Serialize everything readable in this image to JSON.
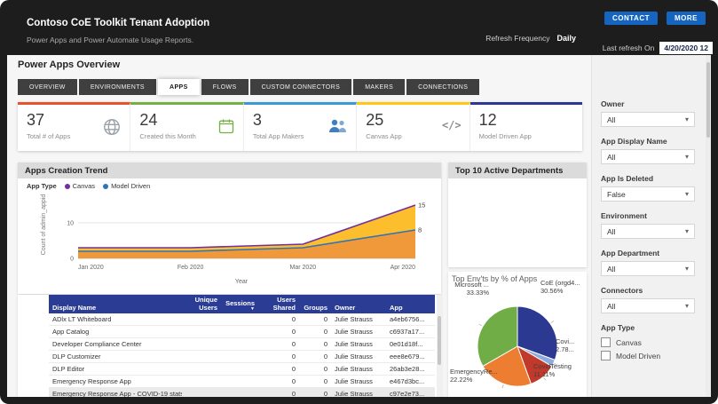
{
  "header": {
    "title": "Contoso CoE Toolkit Tenant Adoption",
    "subtitle": "Power Apps and Power Automate Usage Reports.",
    "contact_label": "CONTACT",
    "more_label": "MORE",
    "refresh_frequency_label": "Refresh Frequency",
    "refresh_frequency_value": "Daily",
    "last_refresh_label": "Last refresh On",
    "last_refresh_value": "4/20/2020 12"
  },
  "page": {
    "title": "Power Apps Overview",
    "tabs": [
      {
        "label": "OVERVIEW",
        "active": false
      },
      {
        "label": "ENVIRONMENTS",
        "active": false
      },
      {
        "label": "APPS",
        "active": true
      },
      {
        "label": "FLOWS",
        "active": false
      },
      {
        "label": "CUSTOM CONNECTORS",
        "active": false
      },
      {
        "label": "MAKERS",
        "active": false
      },
      {
        "label": "CONNECTIONS",
        "active": false
      }
    ]
  },
  "kpis": [
    {
      "value": "37",
      "label": "Total # of Apps",
      "icon": "globe-icon",
      "accent": "#E8532E"
    },
    {
      "value": "24",
      "label": "Created this Month",
      "icon": "calendar-icon",
      "accent": "#74B045"
    },
    {
      "value": "3",
      "label": "Total App Makers",
      "icon": "people-icon",
      "accent": "#3B99D4"
    },
    {
      "value": "25",
      "label": "Canvas App",
      "icon": "code-icon",
      "accent": "#FFC716"
    },
    {
      "value": "12",
      "label": "Model Driven App",
      "icon": null,
      "accent": "#2B3990"
    }
  ],
  "panels": {
    "departments_title": "Top 10 Active Departments"
  },
  "chart_data": [
    {
      "type": "area",
      "title": "Apps Creation Trend",
      "legend_title": "App Type",
      "x": [
        "Jan 2020",
        "Feb 2020",
        "Mar 2020",
        "Apr 2020"
      ],
      "series": [
        {
          "name": "Canvas",
          "values": [
            3,
            3,
            4,
            15
          ],
          "stroke": "#71309F",
          "fill": "#FDBE2E"
        },
        {
          "name": "Model Driven",
          "values": [
            2,
            2,
            3,
            8
          ],
          "stroke": "#2E75B6",
          "fill": "#F0993A"
        }
      ],
      "xlabel": "Year",
      "ylabel": "Count of admin_appid",
      "ylim": [
        0,
        15
      ],
      "yticks": [
        0,
        10
      ],
      "end_labels": [
        "15",
        "8"
      ],
      "legend_position": "top-left",
      "grid": true
    },
    {
      "type": "pie",
      "title": "Top Env'ts by % of Apps",
      "slices": [
        {
          "label": "CoE (orgd4...",
          "pct": 30.56,
          "pct_label": "30.56%",
          "color": "#2B3990"
        },
        {
          "label": "Covi...",
          "pct": 2.78,
          "pct_label": "2.78...",
          "color": "#8FAADC"
        },
        {
          "label": "CovidTesting",
          "pct": 11.11,
          "pct_label": "11.11%",
          "color": "#C0392B"
        },
        {
          "label": "EmergencyRe...",
          "pct": 22.22,
          "pct_label": "22.22%",
          "color": "#ED7D31"
        },
        {
          "label": "Microsoft ...",
          "pct": 33.33,
          "pct_label": "33.33%",
          "color": "#70AD47"
        }
      ]
    }
  ],
  "table": {
    "header_bg": "#2B3C94",
    "headers": [
      "Display Name",
      "Unique Users",
      "Sessions",
      "Users Shared",
      "Groups",
      "Owner",
      "App"
    ],
    "sorted_column": "Sessions",
    "rows": [
      [
        "ADlx LT Whiteboard",
        "",
        "",
        "0",
        "0",
        "Julie Strauss",
        "a4eb6756..."
      ],
      [
        "App Catalog",
        "",
        "",
        "0",
        "0",
        "Julie Strauss",
        "c6937a17..."
      ],
      [
        "Developer Compliance Center",
        "",
        "",
        "0",
        "0",
        "Julie Strauss",
        "0e01d18f..."
      ],
      [
        "DLP Customizer",
        "",
        "",
        "0",
        "0",
        "Julie Strauss",
        "eee8e679..."
      ],
      [
        "DLP Editor",
        "",
        "",
        "0",
        "0",
        "Julie Strauss",
        "26ab3e28..."
      ],
      [
        "Emergency Response App",
        "",
        "",
        "0",
        "0",
        "Julie Strauss",
        "e467d3bc..."
      ],
      [
        "Emergency Response App - COVID-19 stats",
        "",
        "",
        "0",
        "0",
        "Julie Strauss",
        "c97e2e73..."
      ]
    ]
  },
  "filters": {
    "groups": [
      {
        "label": "Owner",
        "type": "dropdown",
        "value": "All"
      },
      {
        "label": "App Display Name",
        "type": "dropdown",
        "value": "All"
      },
      {
        "label": "App Is Deleted",
        "type": "dropdown",
        "value": "False"
      },
      {
        "label": "Environment",
        "type": "dropdown",
        "value": "All"
      },
      {
        "label": "App Department",
        "type": "dropdown",
        "value": "All"
      },
      {
        "label": "Connectors",
        "type": "dropdown",
        "value": "All"
      },
      {
        "label": "App Type",
        "type": "checkboxes",
        "options": [
          {
            "label": "Canvas",
            "checked": false
          },
          {
            "label": "Model Driven",
            "checked": false
          }
        ]
      }
    ]
  }
}
